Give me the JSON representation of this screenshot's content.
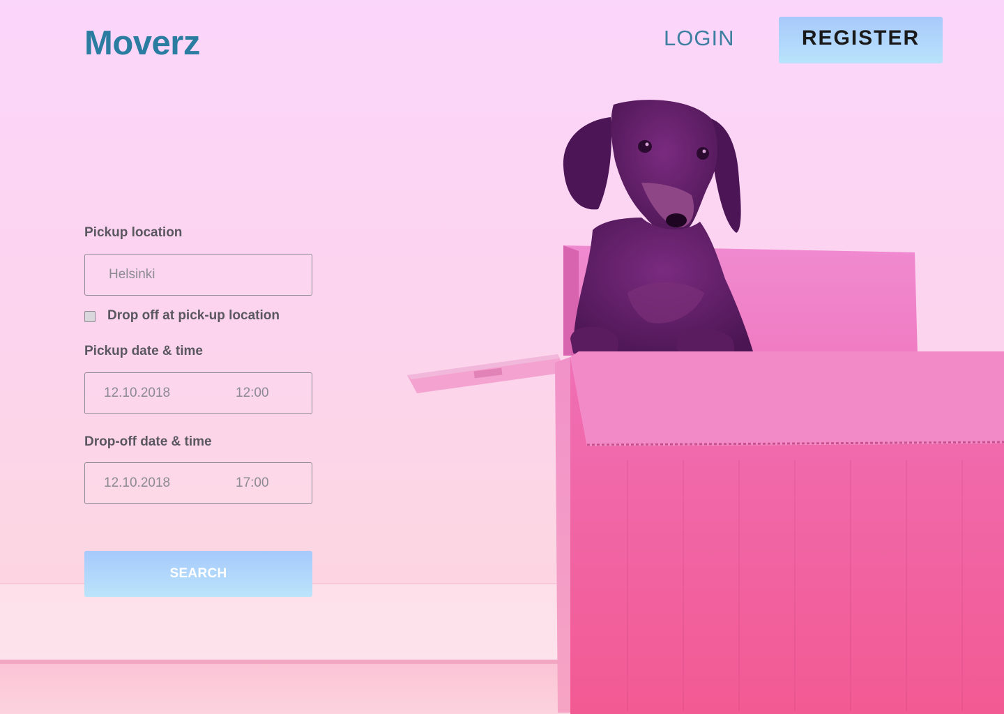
{
  "header": {
    "logo": "Moverz",
    "login_label": "LOGIN",
    "register_label": "REGISTER"
  },
  "form": {
    "pickup_location": {
      "label": "Pickup location",
      "value": "Helsinki"
    },
    "drop_off_same": {
      "label": "Drop off at pick-up location",
      "checked": false
    },
    "pickup_datetime": {
      "label": "Pickup date & time",
      "date": "12.10.2018",
      "time": "12:00"
    },
    "dropoff_datetime": {
      "label": "Drop-off date & time",
      "date": "12.10.2018",
      "time": "17:00"
    },
    "search_label": "SEARCH"
  },
  "colors": {
    "brand": "#2a7ca0",
    "button_gradient_top": "#a6c9fb",
    "button_gradient_bottom": "#bbe4fb",
    "label_text": "#5a5760"
  },
  "hero": {
    "illustration": "dachshund-in-cardboard-box"
  }
}
